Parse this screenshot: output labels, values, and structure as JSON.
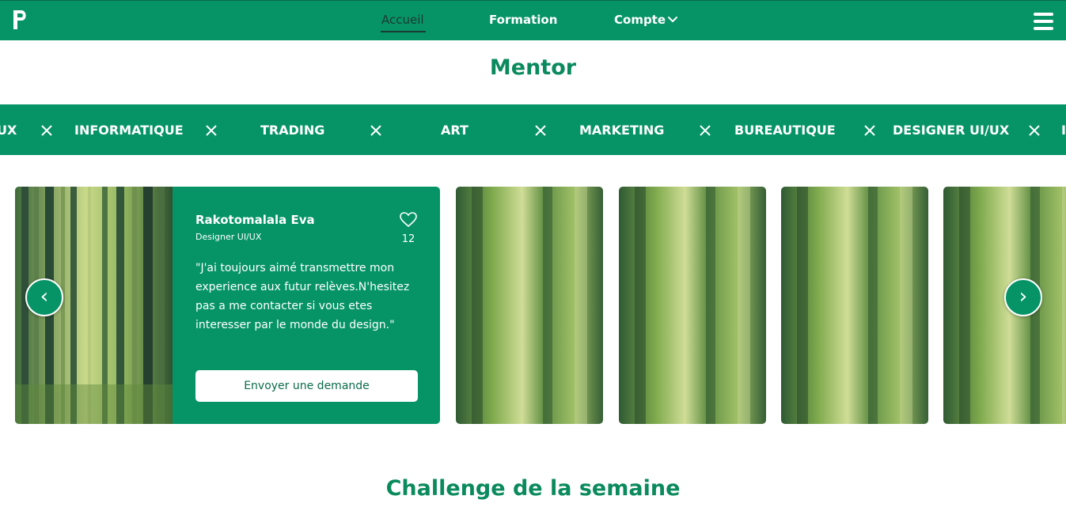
{
  "nav": {
    "logo_letter": "P",
    "links": [
      {
        "label": "Accueil"
      },
      {
        "label": "Formation"
      },
      {
        "label": "Compte"
      }
    ],
    "icons": {
      "dropdown": "chevron-down-icon",
      "menu": "hamburger-menu-icon"
    }
  },
  "page": {
    "title": "Mentor"
  },
  "marquee": {
    "items": [
      "UX",
      "INFORMATIQUE",
      "TRADING",
      "ART",
      "MARKETING",
      "BUREAUTIQUE",
      "DESIGNER UI/UX",
      "I"
    ]
  },
  "featured_mentor": {
    "name": "Rakotomalala Eva",
    "role": "Designer UI/UX",
    "likes": "12",
    "quote": "\"J'ai toujours aimé transmettre mon experience aux futur relèves.N'hesitez pas a me contacter si vous etes interesser par le monde du design.\"",
    "button_label": "Envoyer une demande",
    "photo": "bamboo-forest-photo"
  },
  "carousel": {
    "prev_symbol": "‹",
    "next_symbol": "›",
    "other_cards": [
      "bamboo-forest-photo-blurred",
      "bamboo-forest-photo-blurred",
      "bamboo-forest-photo-blurred",
      "bamboo-forest-photo-blurred"
    ]
  },
  "next_section": {
    "title": "Challenge de la semaine"
  },
  "colors": {
    "brand_green": "#069466",
    "heading_green": "#0a8a5d",
    "dark_text": "#1c3a2f",
    "white": "#ffffff"
  }
}
